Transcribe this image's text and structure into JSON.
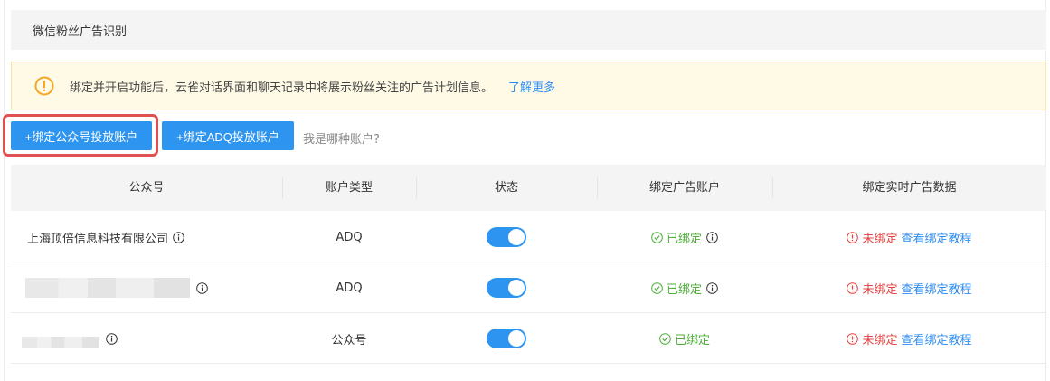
{
  "header": {
    "title": "微信粉丝广告识别"
  },
  "notice": {
    "text": "绑定并开启功能后，云雀对话界面和聊天记录中将展示粉丝关注的广告计划信息。",
    "more_link": "了解更多",
    "icon": "warning-circle-icon",
    "color": "#f5a623"
  },
  "toolbar": {
    "bind_gzh_label": "+绑定公众号投放账户",
    "bind_adq_label": "+绑定ADQ投放账户",
    "which_account_label": "我是哪种账户?",
    "accent": "#2d95f0",
    "highlight": "#e05151"
  },
  "table": {
    "columns": [
      "公众号",
      "账户类型",
      "状态",
      "绑定广告账户",
      "绑定实时广告数据"
    ],
    "rows": [
      {
        "name": "上海顶倍信息科技有限公司",
        "type": "ADQ",
        "enabled": true,
        "bind_status": "已绑定",
        "realtime_status": "未绑定",
        "tutorial": "查看绑定教程"
      },
      {
        "name": "",
        "type": "ADQ",
        "enabled": true,
        "bind_status": "已绑定",
        "realtime_status": "未绑定",
        "tutorial": "查看绑定教程"
      },
      {
        "name": "",
        "type": "公众号",
        "enabled": true,
        "bind_status": "已绑定",
        "realtime_status": "未绑定",
        "tutorial": "查看绑定教程"
      }
    ]
  },
  "colors": {
    "bound": "#4caf36",
    "unbound": "#e64040",
    "link": "#2f8ef3"
  }
}
